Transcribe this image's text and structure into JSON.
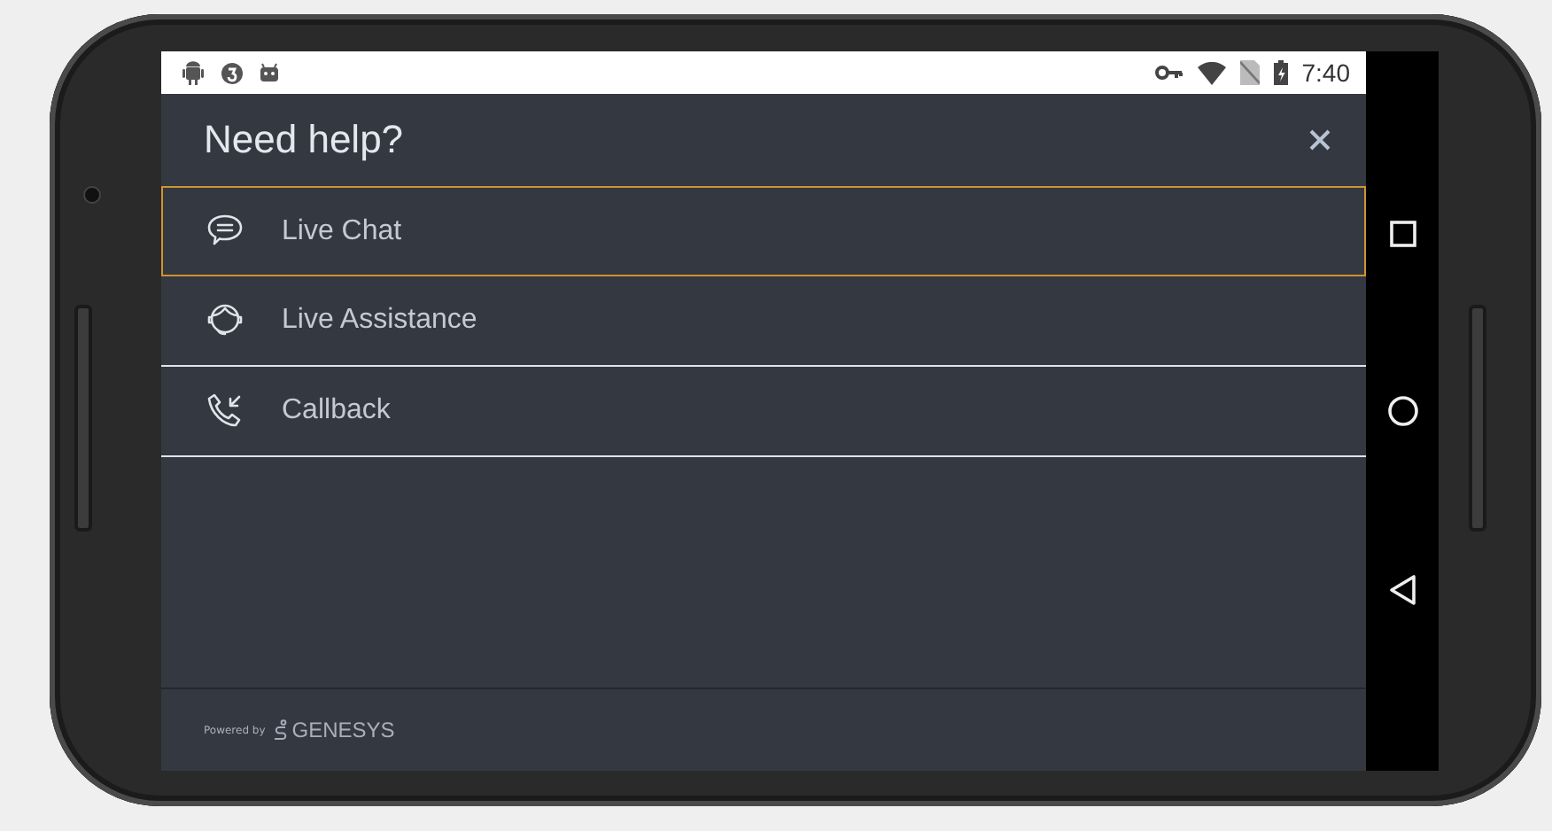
{
  "status_bar": {
    "time": "7:40"
  },
  "header": {
    "title": "Need help?"
  },
  "options": [
    {
      "kind": "chat",
      "label": "Live Chat",
      "selected": true
    },
    {
      "kind": "assistance",
      "label": "Live Assistance",
      "selected": false
    },
    {
      "kind": "callback",
      "label": "Callback",
      "selected": false
    }
  ],
  "footer": {
    "powered_by": "Powered by",
    "brand": "GENESYS"
  }
}
